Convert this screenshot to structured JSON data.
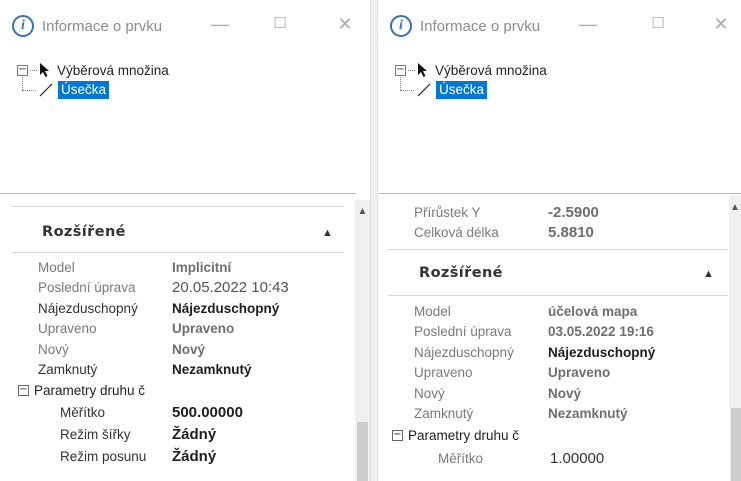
{
  "left": {
    "title": "Informace o prvku",
    "tree": {
      "root": "Výběrová množina",
      "child": "Úsečka"
    },
    "section": "Rozšířené",
    "rows": [
      {
        "name": "Model",
        "value": "Implicitní"
      },
      {
        "name": "Poslední úprava",
        "value": "20.05.2022 10:43"
      },
      {
        "name": "Nájezduschopný",
        "value": "Nájezduschopný"
      },
      {
        "name": "Upraveno",
        "value": "Upraveno"
      },
      {
        "name": "Nový",
        "value": "Nový"
      },
      {
        "name": "Zamknutý",
        "value": "Nezamknutý"
      }
    ],
    "group": "Parametry druhu č",
    "subrows": [
      {
        "name": "Měřítko",
        "value": "500.00000"
      },
      {
        "name": "Režim šířky",
        "value": "Žádný"
      },
      {
        "name": "Režim posunu",
        "value": "Žádný"
      }
    ]
  },
  "right": {
    "title": "Informace o prvku",
    "tree": {
      "root": "Výběrová množina",
      "child": "Úsečka"
    },
    "top_rows": [
      {
        "name": "Přírůstek Y",
        "value": "-2.5900"
      },
      {
        "name": "Celková délka",
        "value": "5.8810"
      }
    ],
    "section": "Rozšířené",
    "rows": [
      {
        "name": "Model",
        "value": "účelová mapa"
      },
      {
        "name": "Poslední úprava",
        "value": "03.05.2022 19:16"
      },
      {
        "name": "Nájezduschopný",
        "value": "Nájezduschopný"
      },
      {
        "name": "Upraveno",
        "value": "Upraveno"
      },
      {
        "name": "Nový",
        "value": "Nový"
      },
      {
        "name": "Zamknutý",
        "value": "Nezamknutý"
      }
    ],
    "group": "Parametry druhu č",
    "subrows": [
      {
        "name": "Měřítko",
        "value": "1.00000"
      }
    ]
  },
  "window_buttons": {
    "minimize": "—",
    "maximize": "☐",
    "close": "✕"
  },
  "icons": {
    "info": "info-icon",
    "cursor": "cursor-icon",
    "line": "line-icon"
  },
  "colors": {
    "selection": "#0078d7",
    "info_icon": "#3a6fb5"
  }
}
